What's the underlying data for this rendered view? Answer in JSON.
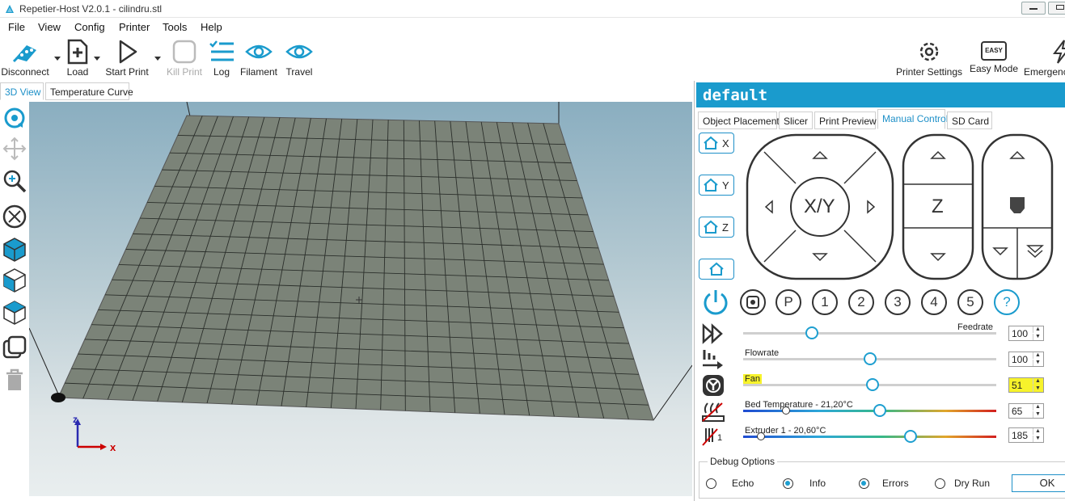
{
  "window": {
    "title": "Repetier-Host V2.0.1 - cilindru.stl"
  },
  "menu": [
    "File",
    "View",
    "Config",
    "Printer",
    "Tools",
    "Help"
  ],
  "toolbar": {
    "disconnect": "Disconnect",
    "load": "Load",
    "start_print": "Start Print",
    "kill_print": "Kill Print",
    "log": "Log",
    "filament": "Filament",
    "travel": "Travel",
    "printer_settings": "Printer Settings",
    "easy_mode": "Easy Mode",
    "easy_badge": "EASY",
    "emergency": "Emergenc"
  },
  "view_tabs": [
    "3D View",
    "Temperature Curve"
  ],
  "axis": {
    "x": "x",
    "z": "z"
  },
  "right_panel": {
    "profile": "default",
    "tabs": [
      "Object Placement",
      "Slicer",
      "Print Preview",
      "Manual Control",
      "SD Card"
    ],
    "active_tab": "Manual Control",
    "home_buttons": [
      "X",
      "Y",
      "Z",
      ""
    ],
    "jog": {
      "xy_label": "X/Y",
      "z_label": "Z"
    },
    "quick_buttons": [
      "P",
      "1",
      "2",
      "3",
      "4",
      "5",
      "?"
    ],
    "sliders": {
      "feedrate": {
        "label": "Feedrate",
        "value": "100",
        "position": 0.27
      },
      "flowrate": {
        "label": "Flowrate",
        "value": "100",
        "position": 0.5
      },
      "fan": {
        "label": "Fan",
        "value": "51",
        "position": 0.51
      },
      "bed": {
        "label": "Bed Temperature - 21,20°C",
        "value": "65",
        "position": 0.54,
        "current": 0.17
      },
      "extruder": {
        "label": "Extruder 1 - 20,60°C",
        "value": "185",
        "position": 0.66,
        "current": 0.07
      }
    },
    "extruder_badge": "1",
    "debug": {
      "title": "Debug Options",
      "options": [
        {
          "label": "Echo",
          "checked": false
        },
        {
          "label": "Info",
          "checked": true
        },
        {
          "label": "Errors",
          "checked": true
        },
        {
          "label": "Dry Run",
          "checked": false
        }
      ],
      "ok": "OK"
    }
  },
  "colors": {
    "accent": "#1a9bcd",
    "highlight": "#f7f32b",
    "bed_plate": "#7b8378"
  }
}
